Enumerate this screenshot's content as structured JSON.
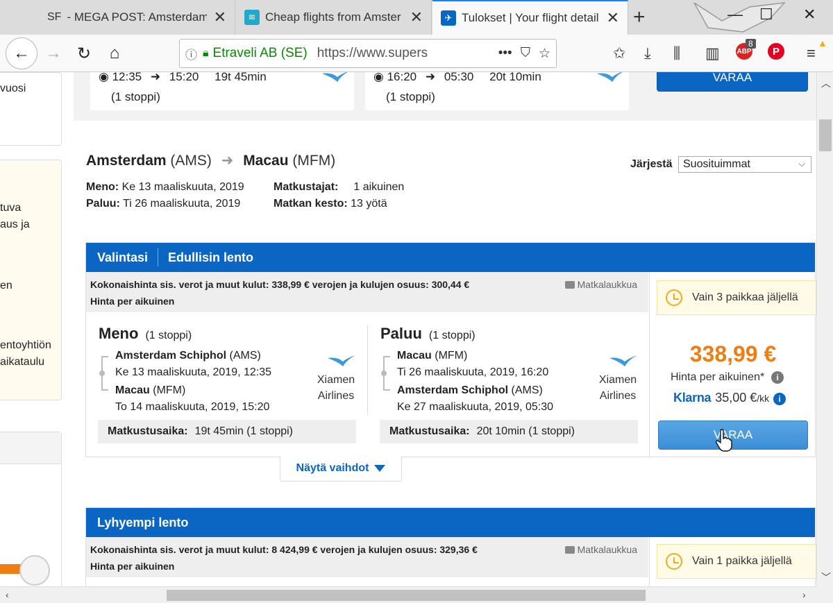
{
  "browser": {
    "tabs": [
      {
        "favicon": "SF",
        "title": "- MEGA POST: Amsterdam"
      },
      {
        "favicon": "wifi",
        "title": "Cheap flights from Amster"
      },
      {
        "favicon": "plane",
        "title": "Tulokset | Your flight detail"
      }
    ],
    "url_identity": "Etraveli AB (SE)",
    "url": "https://www.supers",
    "badge_count": "8"
  },
  "sidebar": {
    "box1": [
      "vuosi"
    ],
    "box2": [
      "tuva",
      "aus ja",
      "en",
      "entoyhtiön",
      "aikataulu"
    ]
  },
  "previous_result": {
    "outbound": {
      "dep": "12:35",
      "arr": "15:20",
      "duration": "19t 45min",
      "stops": "(1 stoppi)"
    },
    "return": {
      "dep": "16:20",
      "arr": "05:30",
      "duration": "20t 10min",
      "stops": "(1 stoppi)"
    },
    "book_label": "VARAA"
  },
  "search": {
    "origin": "Amsterdam",
    "origin_code": "(AMS)",
    "destination": "Macau",
    "destination_code": "(MFM)",
    "depart_label": "Meno:",
    "depart_value": "Ke 13 maaliskuuta, 2019",
    "return_label": "Paluu:",
    "return_value": "Ti 26 maaliskuuta, 2019",
    "travellers_label": "Matkustajat:",
    "travellers_value": "1 aikuinen",
    "duration_label": "Matkan kesto:",
    "duration_value": "13 yötä",
    "sort_label": "Järjestä",
    "sort_value": "Suosituimmat"
  },
  "card1": {
    "tab1": "Valintasi",
    "tab2": "Edullisin lento",
    "total_line": "Kokonaishinta sis. verot ja muut kulut: 338,99 € verojen ja kulujen osuus: 300,44 €",
    "per_person_line": "Hinta per aikuinen",
    "luggage": "Matkalaukkua",
    "outbound": {
      "title": "Meno",
      "stops": "(1 stoppi)",
      "from_airport": "Amsterdam Schiphol",
      "from_code": "(AMS)",
      "from_time": "Ke 13 maaliskuuta, 2019, 12:35",
      "to_airport": "Macau",
      "to_code": "(MFM)",
      "to_time": "To 14 maaliskuuta, 2019, 15:20",
      "airline_1": "Xiamen",
      "airline_2": "Airlines",
      "duration_label": "Matkustusaika:",
      "duration_value": "19t 45min (1 stoppi)"
    },
    "return": {
      "title": "Paluu",
      "stops": "(1 stoppi)",
      "from_airport": "Macau",
      "from_code": "(MFM)",
      "from_time": "Ti 26 maaliskuuta, 2019, 16:20",
      "to_airport": "Amsterdam Schiphol",
      "to_code": "(AMS)",
      "to_time": "Ke 27 maaliskuuta, 2019, 05:30",
      "airline_1": "Xiamen",
      "airline_2": "Airlines",
      "duration_label": "Matkustusaika:",
      "duration_value": "20t 10min (1 stoppi)"
    },
    "seats_left": "Vain 3 paikkaa jäljellä",
    "price": "338,99 €",
    "price_note": "Hinta per aikuinen*",
    "klarna_logo": "Klarna",
    "klarna_amount": "35,00 €",
    "klarna_unit": "/kk",
    "book_label": "VARAA",
    "show_stops": "Näytä vaihdot"
  },
  "card2": {
    "tab1": "Lyhyempi lento",
    "total_line": "Kokonaishinta sis. verot ja muut kulut: 8 424,99 € verojen ja kulujen osuus: 329,36 €",
    "per_person_line": "Hinta per aikuinen",
    "luggage": "Matkalaukkua",
    "seats_left": "Vain 1 paikka jäljellä"
  },
  "colors": {
    "brand_blue": "#0a66c2",
    "price_orange": "#f07d12",
    "secure_green": "#058b00"
  }
}
